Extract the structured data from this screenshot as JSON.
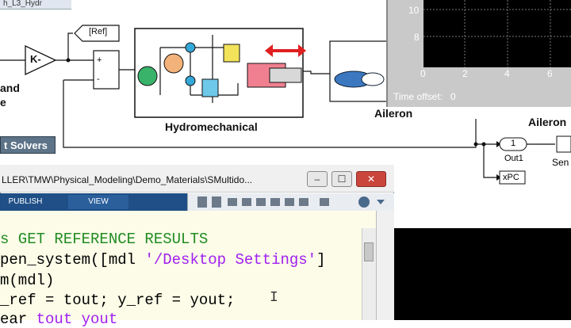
{
  "model": {
    "title_fragment": "h_L3_Hydr",
    "gain_label": "K-",
    "ref_goto_label": "[Ref]",
    "sum_plus": "+",
    "sum_minus": "-",
    "left_label_1": "and",
    "left_label_2": "e",
    "hydro_label": "Hydromechanical",
    "aileron_label": "Aileron",
    "aileron_right_label": "Aileron",
    "solvers_button": "t Solvers",
    "out1_port": "1",
    "out1_label": "Out1",
    "xpc_label": "xPC",
    "sen_label": "Sen"
  },
  "scope": {
    "y_ticks": [
      "10",
      "8"
    ],
    "x_ticks": [
      "0",
      "2",
      "4",
      "6"
    ],
    "time_offset_label": "Time offset:",
    "time_offset_value": "0"
  },
  "editor": {
    "path": "LLER\\TMW\\Physical_Modeling\\Demo_Materials\\SMultido...",
    "tabs": [
      "PUBLISH",
      "VIEW"
    ],
    "code_lines": [
      {
        "a": "s GET REFERENCE RESULTS",
        "color": "#228b22"
      },
      {
        "a": "pen_system([mdl ",
        "b": "'/Desktop Settings'",
        "c": "]"
      },
      {
        "a": "m(mdl)"
      },
      {
        "a": "_ref = tout; y_ref = yout;"
      },
      {
        "a": "ear ",
        "b": "tout yout"
      }
    ],
    "window_buttons": [
      "–",
      "☐",
      "✕"
    ]
  }
}
